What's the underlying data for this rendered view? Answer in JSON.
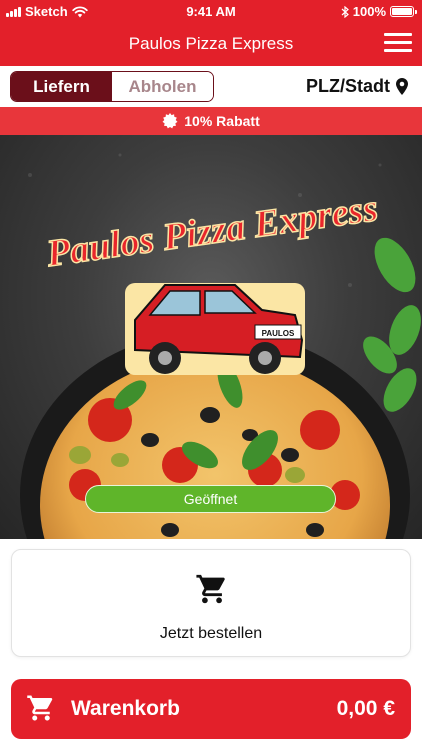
{
  "status_bar": {
    "carrier": "Sketch",
    "time": "9:41 AM",
    "battery": "100%"
  },
  "header": {
    "title": "Paulos Pizza Express",
    "menu_icon": "hamburger-menu-icon"
  },
  "mode_toggle": {
    "options": [
      "Liefern",
      "Abholen"
    ],
    "selected": "Liefern"
  },
  "location": {
    "label": "PLZ/Stadt",
    "icon": "map-pin-icon"
  },
  "discount": {
    "label": "10% Rabatt",
    "icon": "badge-icon"
  },
  "hero": {
    "logo_text": "Paulos Pizza Express",
    "plate_text": "PAULOS",
    "status": "Geöffnet"
  },
  "order": {
    "label": "Jetzt bestellen",
    "icon": "cart-icon"
  },
  "cart": {
    "label": "Warenkorb",
    "total": "0,00 €",
    "icon": "cart-icon"
  },
  "colors": {
    "brand_red": "#e3202a",
    "discount_red": "#e8363b",
    "toggle_dark": "#6b0f1a",
    "open_green": "#5fb52a"
  }
}
